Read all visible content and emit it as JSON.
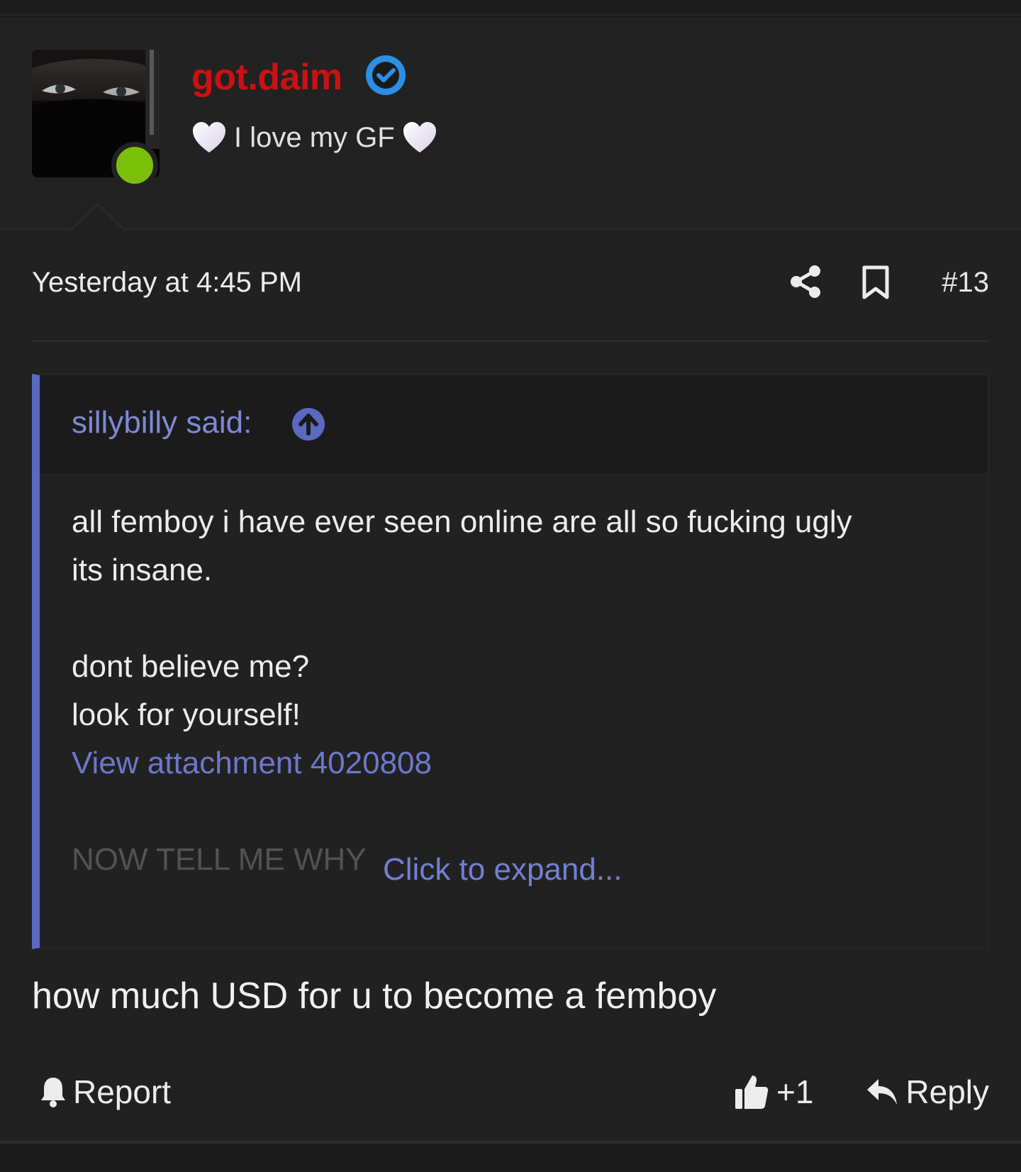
{
  "post": {
    "username": "got.daim",
    "user_title": "I love my GF",
    "timestamp": "Yesterday at 4:45 PM",
    "post_number": "#13",
    "quote": {
      "author": "sillybilly said:",
      "lines": [
        "all femboy i have ever seen online are all so fucking ugly",
        "its insane.",
        "dont believe me?",
        "look for yourself!"
      ],
      "attachment_link": "View attachment 4020808",
      "faded_line": "NOW TELL ME WHY",
      "expand_label": "Click to expand..."
    },
    "reply_body": "how much USD for u to become a femboy",
    "actions": {
      "report_label": "Report",
      "reaction_label": "+1",
      "reply_label": "Reply"
    }
  },
  "icons": {
    "verified": "verified-badge-icon",
    "heart": "white-heart-icon",
    "share": "share-icon",
    "bookmark": "bookmark-icon",
    "quote_jump": "arrow-up-circle-icon",
    "report": "bell-icon",
    "like": "thumbs-up-icon",
    "reply": "reply-arrow-icon"
  },
  "colors": {
    "username": "#cc1111",
    "accent": "#5b69c1",
    "link": "#6c78c9",
    "verified": "#2d8ee6",
    "online": "#7cbf0a",
    "background": "#212122"
  }
}
